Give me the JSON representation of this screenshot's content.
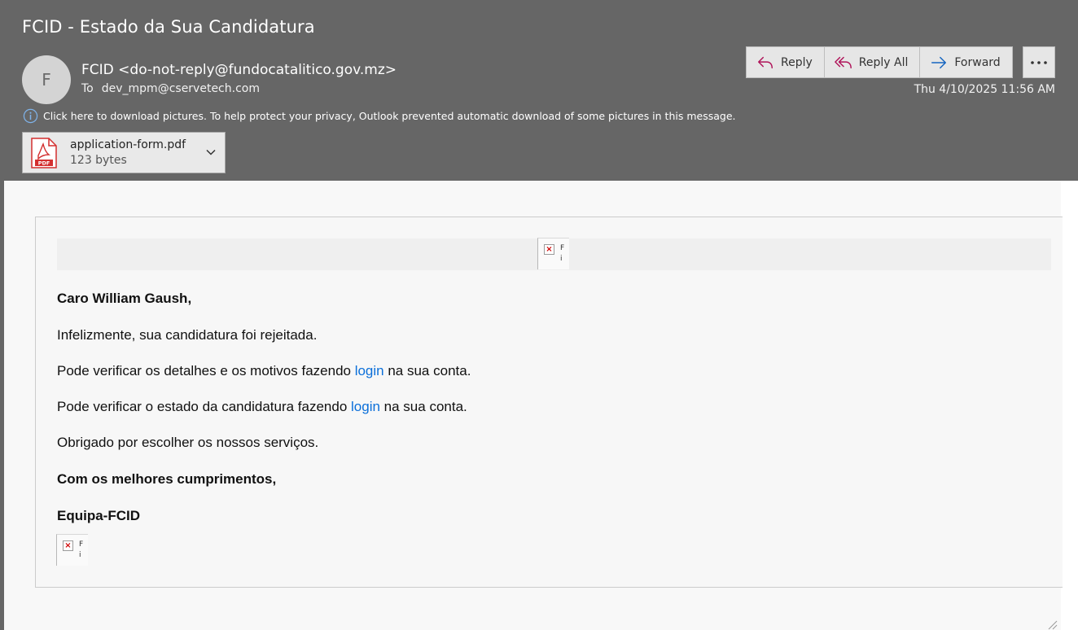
{
  "email": {
    "subject": "FCID - Estado da Sua Candidatura",
    "avatar_initial": "F",
    "sender": "FCID <do-not-reply@fundocatalitico.gov.mz>",
    "to_label": "To",
    "recipient": "dev_mpm@cservetech.com",
    "timestamp": "Thu 4/10/2025 11:56 AM",
    "info_message": "Click here to download pictures. To help protect your privacy, Outlook prevented automatic download of some pictures in this message."
  },
  "actions": {
    "reply": "Reply",
    "reply_all": "Reply All",
    "forward": "Forward"
  },
  "attachment": {
    "name": "application-form.pdf",
    "size": "123 bytes"
  },
  "body": {
    "greeting": "Caro William Gaush,",
    "line1": "Infelizmente, sua candidatura foi rejeitada.",
    "line2_before": "Pode verificar os detalhes e os motivos fazendo ",
    "line2_link": "login",
    "line2_after": " na sua conta.",
    "line3_before": "Pode verificar o estado da candidatura fazendo ",
    "line3_link": "login",
    "line3_after": " na sua conta.",
    "line4": "Obrigado por escolher os nossos serviços.",
    "closing": "Com os melhores cumprimentos,",
    "signature": "Equipa-FCID"
  },
  "colors": {
    "header_bg": "#666666",
    "link": "#0b6fd9",
    "reply_icon": "#b0145a",
    "forward_icon": "#1565c0"
  }
}
